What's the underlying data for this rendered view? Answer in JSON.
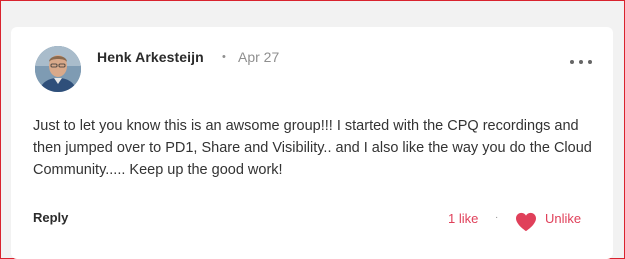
{
  "comment": {
    "author": "Henk Arkesteijn",
    "separator": "•",
    "date": "Apr 27",
    "text": "Just to let you know this is an awsome group!!! I started with the CPQ recordings and then jumped over to PD1, Share and Visibility.. and I also like the way you do the Cloud Community..... Keep up the good work!",
    "more_icon": "more-options-icon"
  },
  "actions": {
    "reply_label": "Reply",
    "likes_label": "1 like",
    "separator": "·",
    "unlike_label": "Unlike",
    "heart_icon": "heart-icon"
  },
  "colors": {
    "accent": "#e0405a",
    "frame_border": "#d9232e",
    "card_bg": "#ffffff"
  }
}
